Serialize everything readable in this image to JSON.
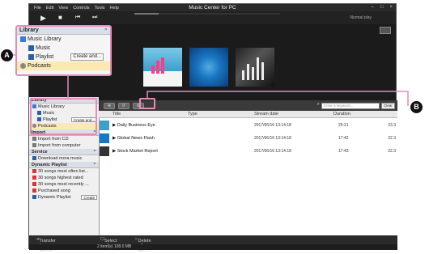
{
  "app": {
    "title": "Music Center for PC",
    "menus": [
      "File",
      "Edit",
      "View",
      "Controls",
      "Tools",
      "Help"
    ],
    "play_mode": "Normal play"
  },
  "callout": {
    "header": "Library",
    "items": [
      "Music Library",
      "Music",
      "Playlist",
      "Podcasts"
    ],
    "create_button": "Create and..."
  },
  "sidebar": {
    "library": {
      "header": "Library",
      "items": [
        "Music Library",
        "Music",
        "Playlist",
        "Podcasts"
      ],
      "create_button": "Create and..."
    },
    "import": {
      "header": "Import",
      "items": [
        "Import from CD",
        "Import from computer"
      ]
    },
    "service": {
      "header": "Service",
      "items": [
        "Download mora music"
      ]
    },
    "dynamic": {
      "header": "Dynamic Playlist",
      "items": [
        "30 songs most often list...",
        "30 songs highest rated",
        "30 songs most recently ...",
        "Purchased song",
        "Dynamic Playlist"
      ],
      "create_button": "Create"
    }
  },
  "list": {
    "search_placeholder": "Enter a keyword...",
    "clear_label": "Clear",
    "columns": [
      "Title",
      "Type",
      "Stream date",
      "Duration"
    ],
    "rows": [
      {
        "title": "Daily Business Eye",
        "date": "2017/06/16 13:14:18",
        "duration": "25:21",
        "extra": "23.3"
      },
      {
        "title": "Global News Flash",
        "date": "2017/06/16 13:14:18",
        "duration": "17:42",
        "extra": "22.3"
      },
      {
        "title": "Stock Market Report",
        "date": "2017/06/16 13:14:18",
        "duration": "17:43",
        "extra": "22.3"
      }
    ]
  },
  "bottom": {
    "transfer": "Transfer to device",
    "select_all": "Select all",
    "delete_all": "Delete all sel...",
    "status": "2 item(s) 108.0 MB"
  },
  "annotations": {
    "a": "A",
    "b": "B"
  },
  "colors": {
    "highlight": "#e88aba",
    "selected": "#fbeab0"
  }
}
